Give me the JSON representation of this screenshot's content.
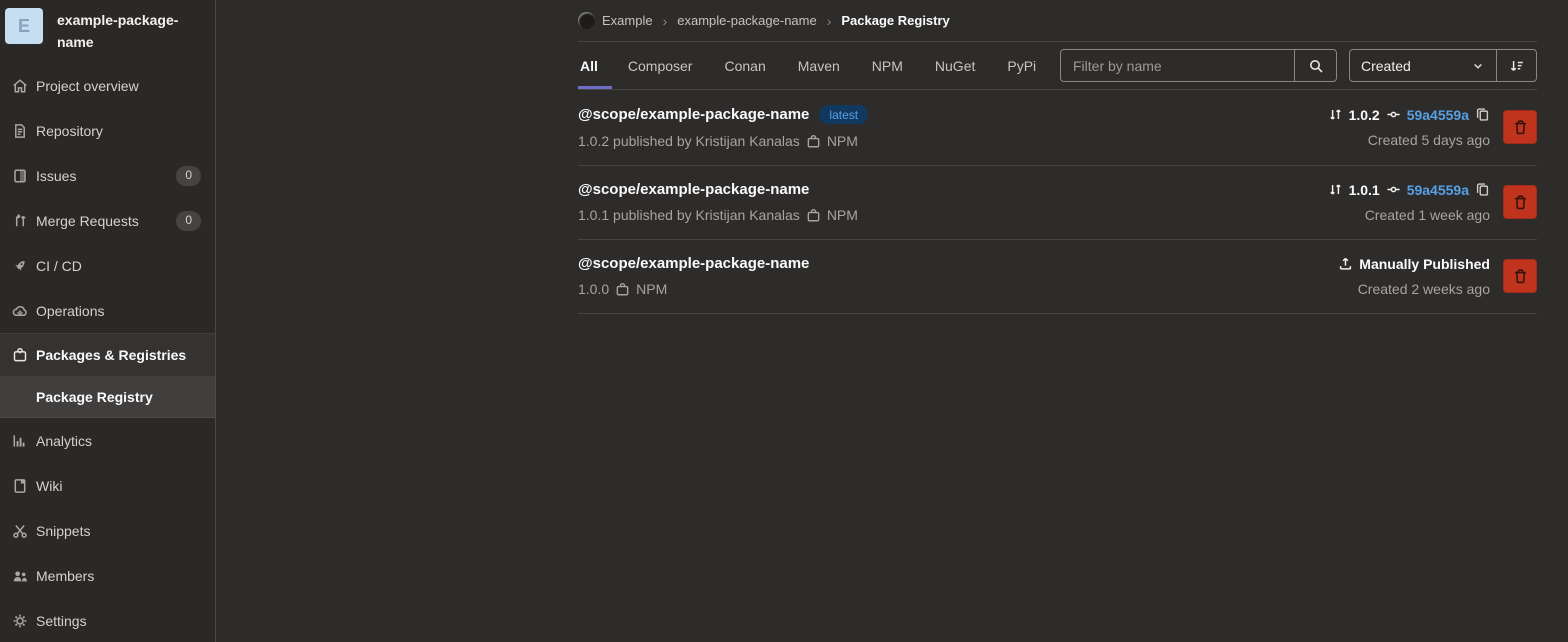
{
  "project": {
    "avatar_letter": "E",
    "name": "example-package-name"
  },
  "sidebar": {
    "items": [
      {
        "label": "Project overview"
      },
      {
        "label": "Repository"
      },
      {
        "label": "Issues",
        "badge": "0"
      },
      {
        "label": "Merge Requests",
        "badge": "0"
      },
      {
        "label": "CI / CD"
      },
      {
        "label": "Operations"
      },
      {
        "label": "Packages & Registries"
      },
      {
        "label": "Package Registry"
      },
      {
        "label": "Analytics"
      },
      {
        "label": "Wiki"
      },
      {
        "label": "Snippets"
      },
      {
        "label": "Members"
      },
      {
        "label": "Settings"
      }
    ]
  },
  "breadcrumb": {
    "items": [
      "Example",
      "example-package-name",
      "Package Registry"
    ],
    "separator": "›"
  },
  "tabs": [
    "All",
    "Composer",
    "Conan",
    "Maven",
    "NPM",
    "NuGet",
    "PyPi"
  ],
  "filter": {
    "placeholder": "Filter by name",
    "sort_label": "Created"
  },
  "packages": [
    {
      "name": "@scope/example-package-name",
      "tag": "latest",
      "meta": "1.0.2 published by Kristijan Kanalas",
      "type": "NPM",
      "version": "1.0.2",
      "commit": "59a4559a",
      "created": "Created 5 days ago"
    },
    {
      "name": "@scope/example-package-name",
      "meta": "1.0.1 published by Kristijan Kanalas",
      "type": "NPM",
      "version": "1.0.1",
      "commit": "59a4559a",
      "created": "Created 1 week ago"
    },
    {
      "name": "@scope/example-package-name",
      "meta": "1.0.0",
      "type": "NPM",
      "publish_method": "Manually Published",
      "created": "Created 2 weeks ago"
    }
  ],
  "colors": {
    "accent_tab": "#6e6ec9",
    "link": "#57a0e5",
    "danger": "#c0341d",
    "badge_info_bg": "#11395f",
    "badge_info_text": "#58a0e6"
  }
}
